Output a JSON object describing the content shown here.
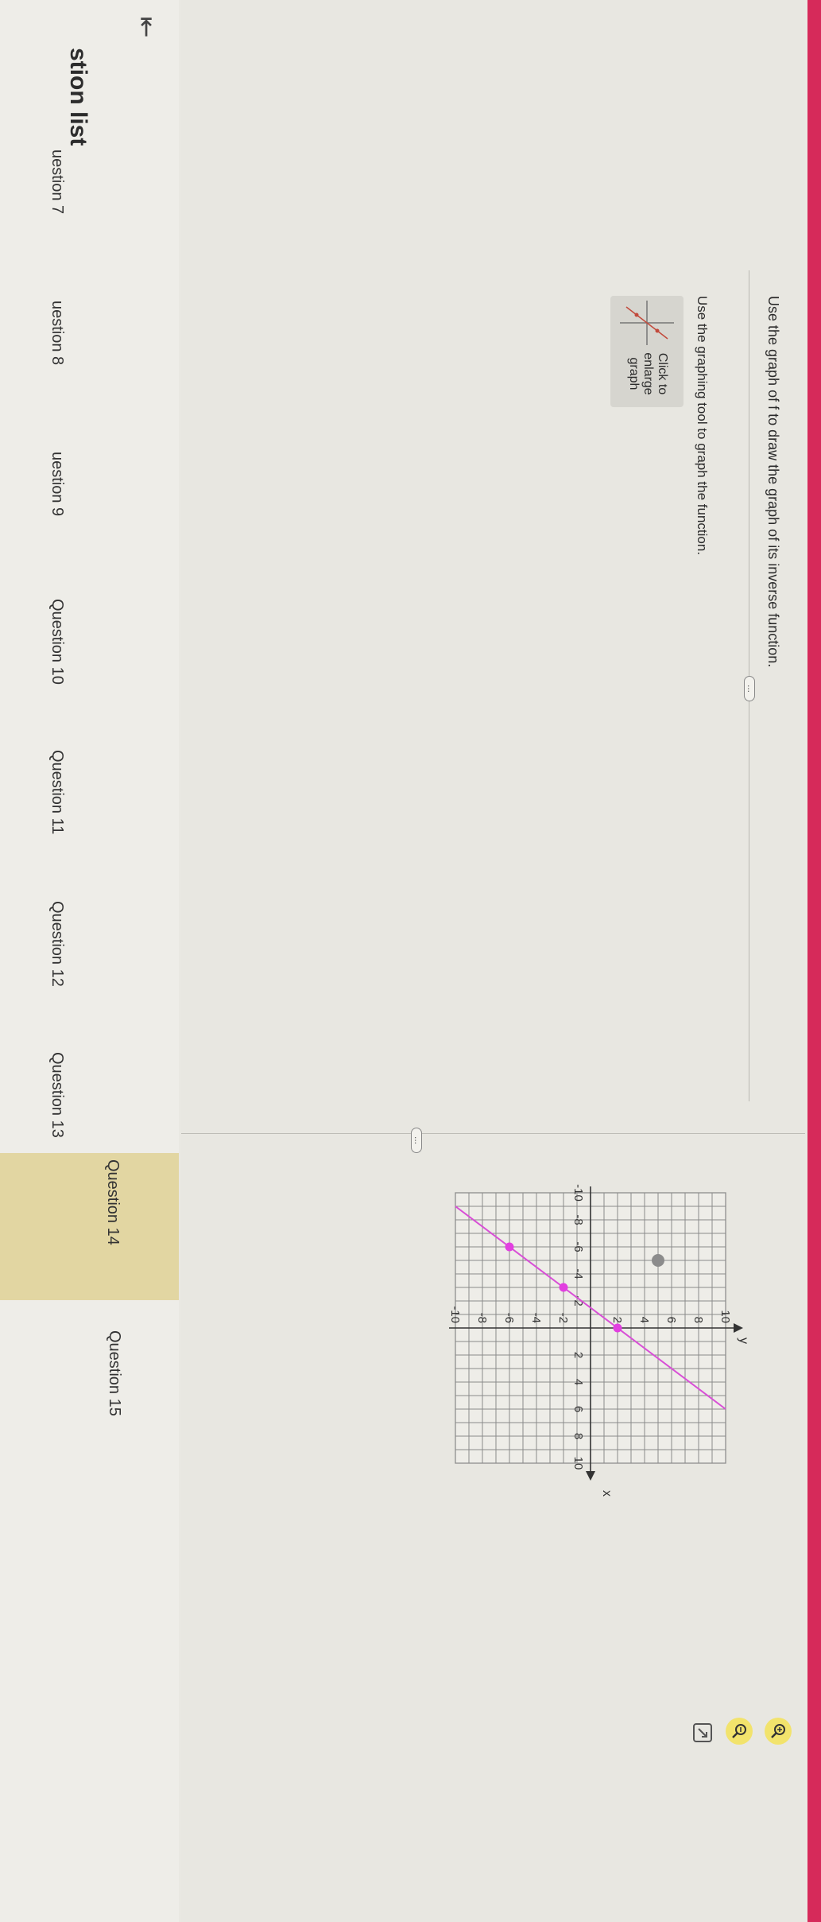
{
  "sidebar": {
    "title": "stion list",
    "items": [
      {
        "label": "uestion 7",
        "active": false
      },
      {
        "label": "uestion 8",
        "active": false
      },
      {
        "label": "uestion 9",
        "active": false
      },
      {
        "label": "Question 10",
        "active": false
      },
      {
        "label": "Question 11",
        "active": false
      },
      {
        "label": "Question 12",
        "active": false
      },
      {
        "label": "Question 13",
        "active": false
      },
      {
        "label": "Question 14",
        "active": true
      },
      {
        "label": "Question 15",
        "active": false
      }
    ]
  },
  "question": {
    "prompt": "Use the graph of f to draw the graph of its inverse function.",
    "instruction": "Use the graphing tool to graph the function.",
    "thumbnail_label": "Click to enlarge graph",
    "more_label": "..."
  },
  "graph": {
    "x_label": "x",
    "y_label": "y",
    "xlim": [
      -10,
      10
    ],
    "ylim": [
      -10,
      10
    ],
    "x_ticks": [
      "-10",
      "-8",
      "-6",
      "-4",
      "-2",
      "2",
      "4",
      "6",
      "8",
      "10"
    ],
    "y_ticks": [
      "10",
      "8",
      "6",
      "4",
      "2",
      "-2",
      "-4",
      "-6",
      "-8",
      "-10"
    ],
    "grid": true,
    "line_color": "#d84fd6",
    "point_color": "#e23fe0",
    "gray_point_color": "#8c8c8c",
    "function_line": {
      "x1": -9,
      "y1": -10,
      "x2": 6,
      "y2": 10
    },
    "function_points": [
      {
        "x": 0,
        "y": 2
      },
      {
        "x": -3,
        "y": -2
      },
      {
        "x": -6,
        "y": -6
      }
    ],
    "gray_point": {
      "x": -5,
      "y": 5
    }
  },
  "colors": {
    "accent": "#d62a5a",
    "active_item": "#e2d6a2",
    "zoom_button": "#f2e36c"
  },
  "icons": {
    "collapse": "collapse-left-icon",
    "zoom_in": "zoom-in-icon",
    "zoom_out": "zoom-out-icon",
    "expand": "expand-icon"
  }
}
